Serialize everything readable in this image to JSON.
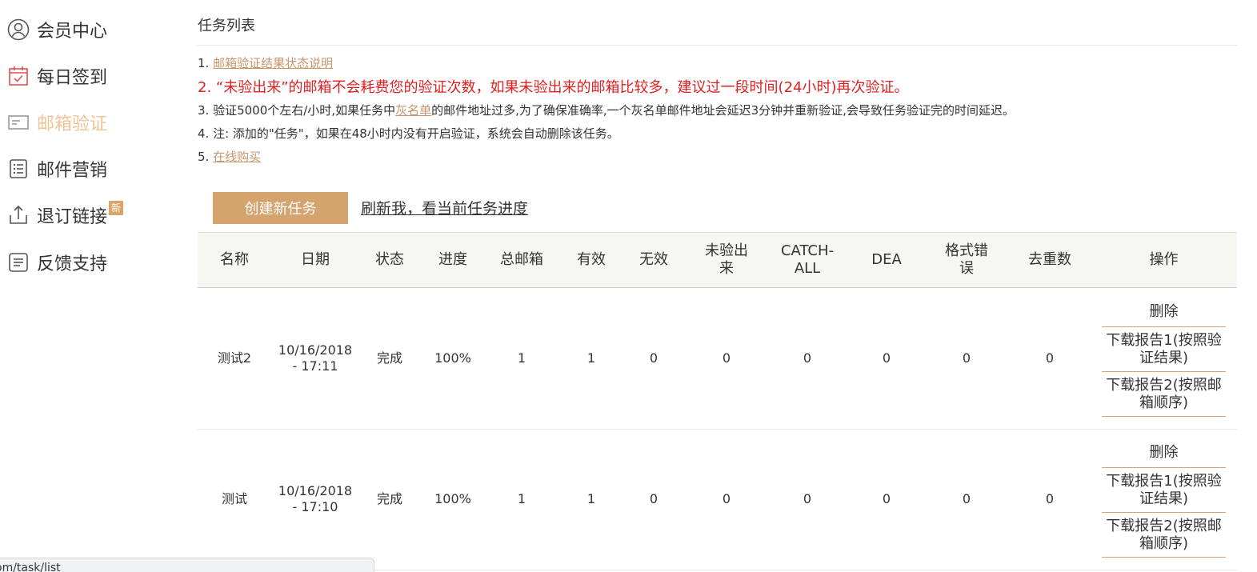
{
  "sidebar": {
    "items": [
      {
        "label": "会员中心",
        "icon": "user-circle-icon"
      },
      {
        "label": "每日签到",
        "icon": "calendar-check-icon"
      },
      {
        "label": "邮箱验证",
        "icon": "email-card-icon",
        "active": true
      },
      {
        "label": "邮件营销",
        "icon": "list-icon"
      },
      {
        "label": "退订链接",
        "icon": "upload-icon",
        "badge": "新"
      },
      {
        "label": "反馈支持",
        "icon": "feedback-icon"
      }
    ]
  },
  "main": {
    "title": "任务列表",
    "notes": {
      "n1_prefix": "1. ",
      "n1_link": "邮箱验证结果状态说明",
      "n2": "2. “未验出来”的邮箱不会耗费您的验证次数，如果未验出来的邮箱比较多，建议过一段时间(24小时)再次验证。",
      "n3_prefix": "3. 验证5000个左右/小时,如果任务中",
      "n3_link": "灰名单",
      "n3_suffix": "的邮件地址过多,为了确保准确率,一个灰名单邮件地址会延迟3分钟并重新验证,会导致任务验证完的时间延迟。",
      "n4": "4. 注: 添加的\"任务\"，如果在48小时内没有开启验证，系统会自动删除该任务。",
      "n5_prefix": "5. ",
      "n5_link": "在线购买"
    },
    "create_button": "创建新任务",
    "refresh_link": "刷新我，看当前任务进度"
  },
  "table": {
    "headers": [
      "名称",
      "日期",
      "状态",
      "进度",
      "总邮箱",
      "有效",
      "无效",
      "未验出来",
      "CATCH-ALL",
      "DEA",
      "格式错误",
      "去重数",
      "操作"
    ],
    "rows": [
      {
        "name": "测试2",
        "date": "10/16/2018 - 17:11",
        "status": "完成",
        "progress": "100%",
        "total": "1",
        "valid": "1",
        "invalid": "0",
        "unverified": "0",
        "catch_all": "0",
        "dea": "0",
        "format_error": "0",
        "dedup": "0",
        "ops": [
          "删除",
          "下载报告1(按照验证结果)",
          "下载报告2(按照邮箱顺序)"
        ]
      },
      {
        "name": "测试",
        "date": "10/16/2018 - 17:10",
        "status": "完成",
        "progress": "100%",
        "total": "1",
        "valid": "1",
        "invalid": "0",
        "unverified": "0",
        "catch_all": "0",
        "dea": "0",
        "format_error": "0",
        "dedup": "0",
        "ops": [
          "删除",
          "下载报告1(按照验证结果)",
          "下载报告2(按照邮箱顺序)"
        ]
      }
    ]
  },
  "status_bar": {
    "url": "om/task/list"
  },
  "colors": {
    "accent": "#d4a36e",
    "active_nav": "#f0c497",
    "link": "#c9956a",
    "warning": "#e02020"
  }
}
